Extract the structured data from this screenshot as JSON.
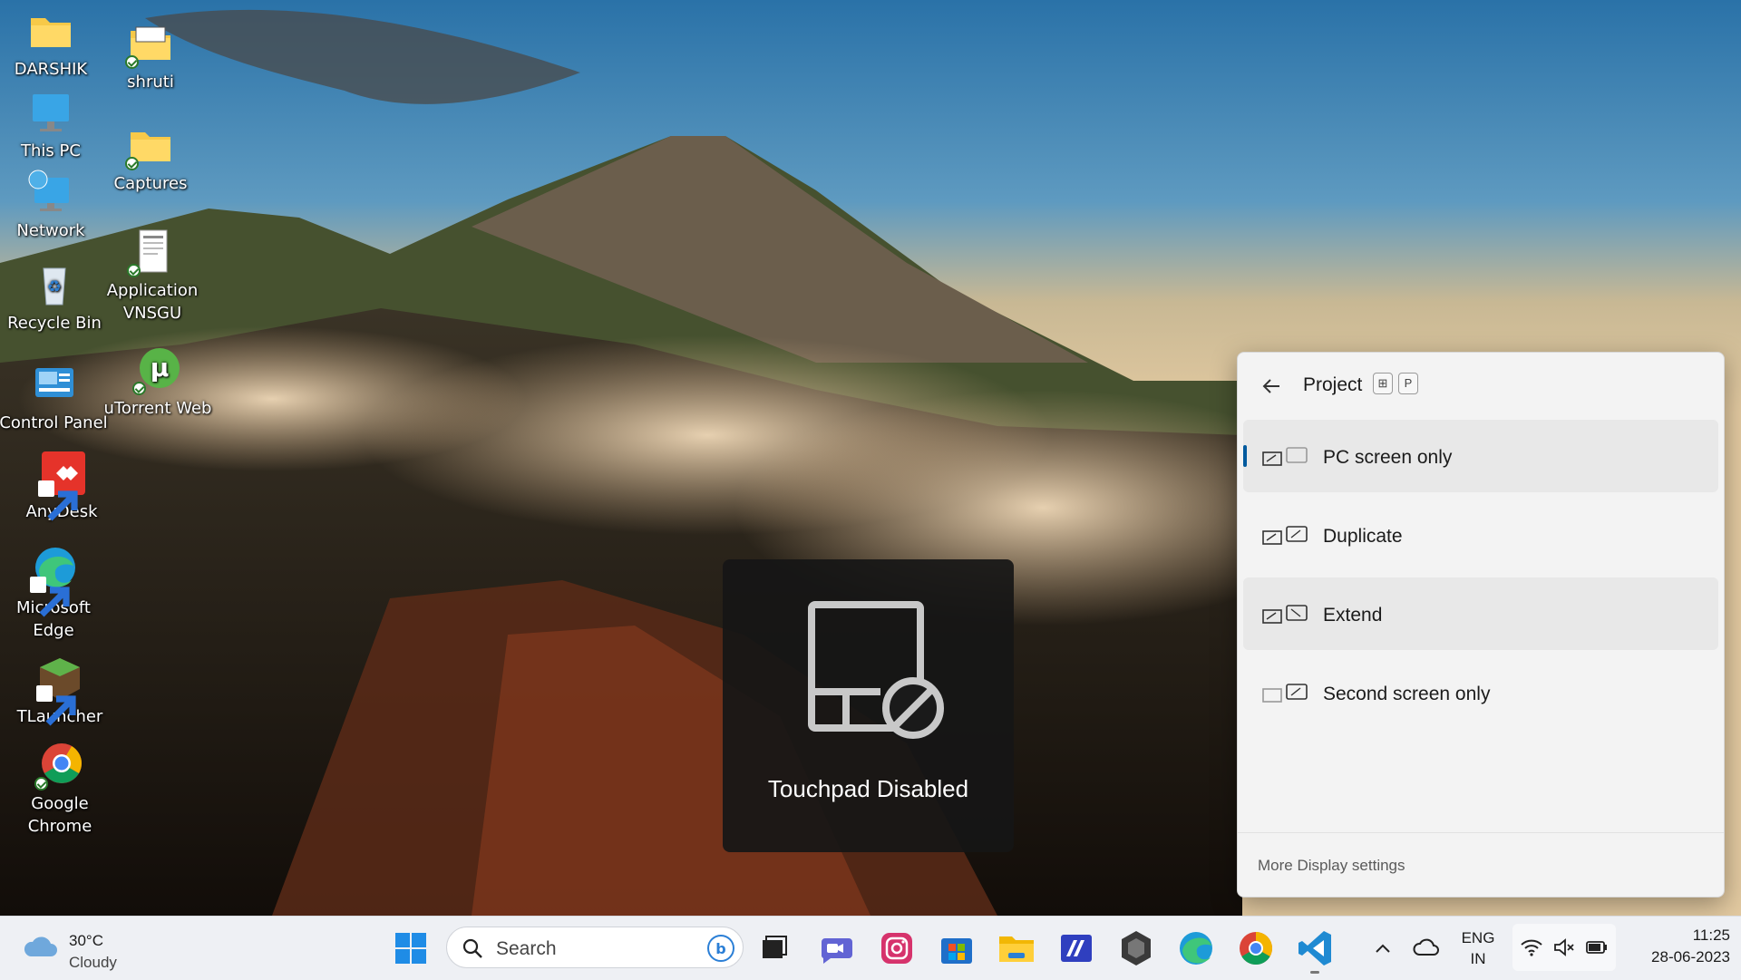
{
  "desktop": {
    "icons": [
      {
        "label": "DARSHIK",
        "icon": "folder-icon"
      },
      {
        "label": "shruti",
        "icon": "folder-icon",
        "synced": true
      },
      {
        "label": "This PC",
        "icon": "monitor-icon"
      },
      {
        "label": "Captures",
        "icon": "folder-icon",
        "synced": true
      },
      {
        "label": "Network",
        "icon": "network-icon"
      },
      {
        "label": "Recycle Bin",
        "icon": "recycle-bin-icon"
      },
      {
        "label": "Application VNSGU",
        "icon": "document-icon",
        "synced": true
      },
      {
        "label": "Control Panel",
        "icon": "control-panel-icon"
      },
      {
        "label": "uTorrent Web",
        "icon": "utorrent-icon",
        "synced": true
      },
      {
        "label": "AnyDesk",
        "icon": "anydesk-icon"
      },
      {
        "label": "Microsoft Edge",
        "icon": "edge-icon"
      },
      {
        "label": "TLauncher",
        "icon": "tlauncher-icon"
      },
      {
        "label": "Google Chrome",
        "icon": "chrome-icon",
        "synced": true
      }
    ]
  },
  "toast": {
    "label": "Touchpad Disabled",
    "icon": "touchpad-disabled-icon"
  },
  "project_panel": {
    "title": "Project",
    "shortcut_keys": [
      "⊞",
      "P"
    ],
    "options": [
      {
        "label": "PC screen only",
        "icon": "pc-screen-only-icon",
        "selected": true
      },
      {
        "label": "Duplicate",
        "icon": "duplicate-icon",
        "selected": false
      },
      {
        "label": "Extend",
        "icon": "extend-icon",
        "selected": false,
        "hovered": true
      },
      {
        "label": "Second screen only",
        "icon": "second-screen-only-icon",
        "selected": false
      }
    ],
    "footer_link": "More Display settings"
  },
  "taskbar": {
    "weather": {
      "temp": "30°C",
      "condition": "Cloudy",
      "icon": "cloud-icon"
    },
    "search_placeholder": "Search",
    "pinned_apps": [
      "windows-start-icon",
      "task-view-icon",
      "teams-chat-icon",
      "instagram-icon",
      "microsoft-store-icon",
      "file-explorer-icon",
      "cursor-app-icon",
      "unity-icon",
      "edge-icon",
      "chrome-icon",
      "vscode-icon"
    ],
    "tray": {
      "language_line1": "ENG",
      "language_line2": "IN",
      "time": "11:25",
      "date": "28-06-2023"
    }
  },
  "colors": {
    "accent": "#005a9e",
    "panel_bg": "#f3f3f3",
    "taskbar_bg": "#eef0f4",
    "toast_bg": "#161616"
  }
}
